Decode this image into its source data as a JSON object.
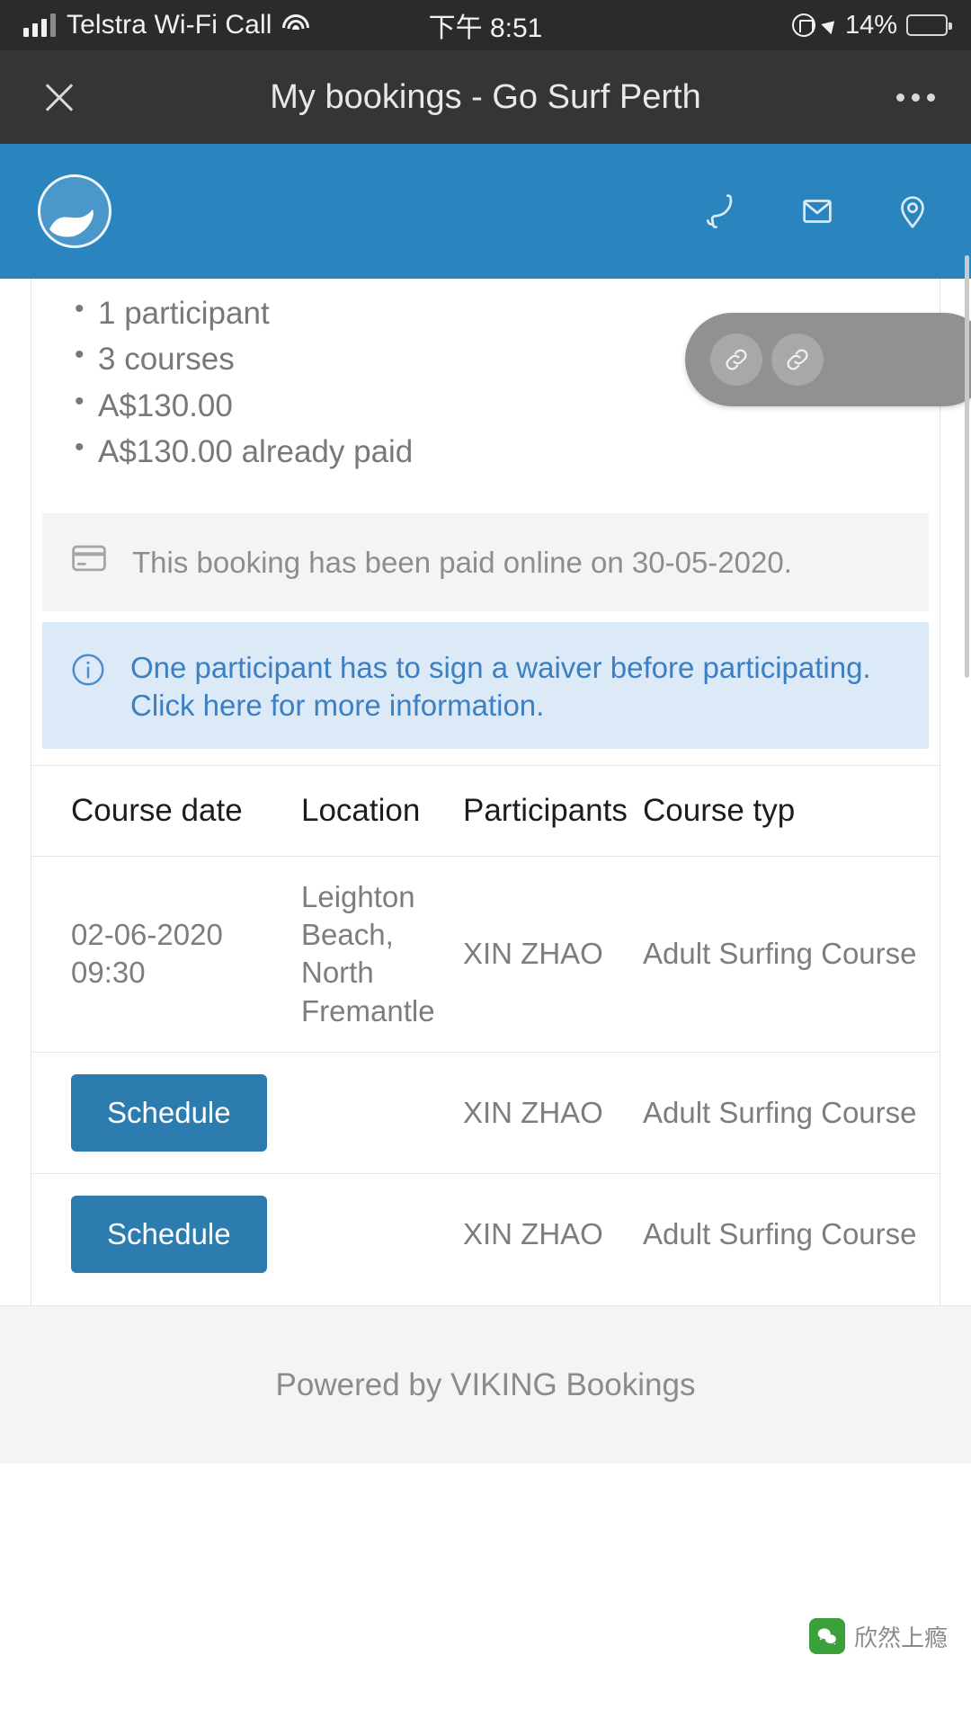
{
  "status_bar": {
    "carrier": "Telstra Wi-Fi Call",
    "time": "下午 8:51",
    "battery_percent": "14%",
    "icons": [
      "signal-bars-icon",
      "wifi-icon",
      "rotation-lock-icon",
      "location-arrow-icon",
      "battery-icon"
    ]
  },
  "nav_bar": {
    "title": "My bookings - Go Surf Perth",
    "close_label": "×",
    "more_label": "•••"
  },
  "brand_header": {
    "logo_name": "go-surf-perth-wave-logo",
    "background_color": "#2a84bd",
    "actions": [
      {
        "name": "phone-icon",
        "label": "Phone"
      },
      {
        "name": "email-icon",
        "label": "Email"
      },
      {
        "name": "location-pin-icon",
        "label": "Location"
      }
    ]
  },
  "booking_summary": {
    "items": [
      "1 participant",
      "3 courses",
      "A$130.00",
      "A$130.00 already paid"
    ]
  },
  "notices": {
    "paid": {
      "icon": "credit-card-icon",
      "text": "This booking has been paid online on 30-05-2020.",
      "background_color": "#f4f4f4",
      "text_color": "#8d8d8d"
    },
    "waiver": {
      "icon": "info-circle-icon",
      "text": "One participant has to sign a waiver before participating. Click here for more information.",
      "background_color": "#dce9f6",
      "text_color": "#3b7fc4"
    }
  },
  "courses_table": {
    "columns": [
      "Course date",
      "Location",
      "Participants",
      "Course typ"
    ],
    "rows": [
      {
        "course_date": "02-06-2020 09:30",
        "date_is_button": false,
        "location": "Leighton Beach, North Fremantle",
        "participants": "XIN ZHAO",
        "course_type": "Adult Surfing Course"
      },
      {
        "course_date": "Schedule",
        "date_is_button": true,
        "location": "",
        "participants": "XIN ZHAO",
        "course_type": "Adult Surfing Course"
      },
      {
        "course_date": "Schedule",
        "date_is_button": true,
        "location": "",
        "participants": "XIN ZHAO",
        "course_type": "Adult Surfing Course"
      }
    ],
    "button_color": "#2d7cb0"
  },
  "footer": {
    "text": "Powered by VIKING Bookings"
  },
  "floating_pill": {
    "buttons": [
      {
        "name": "link-icon-left"
      },
      {
        "name": "link-icon-right"
      }
    ],
    "background_color": "#919191"
  },
  "watermark": {
    "text": "欣然上瘾",
    "badge": "wechat-icon"
  }
}
